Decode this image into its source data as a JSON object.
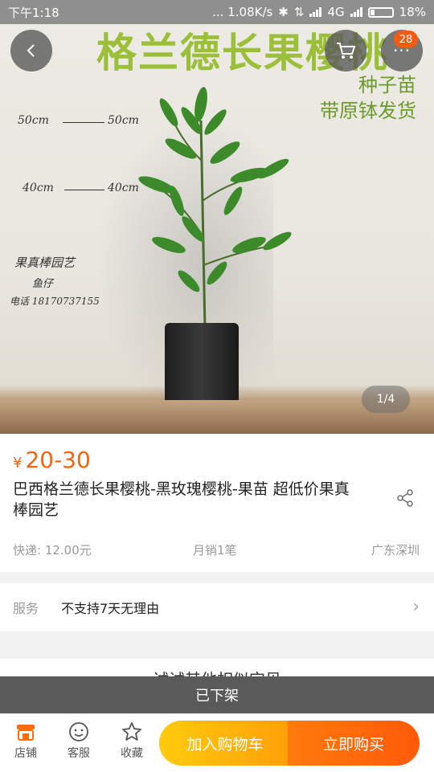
{
  "status_bar": {
    "time": "下午1:18",
    "network_speed": "... 1.08K/s",
    "network_type": "4G",
    "battery": "18%"
  },
  "hero": {
    "overlay_title": "格兰德长果樱桃",
    "overlay_line1": "种子苗",
    "overlay_line2": "带原钵发货",
    "note_top_left": "50cm",
    "note_top_right": "50cm",
    "note_mid_left": "40cm",
    "note_mid_right": "40cm",
    "note_shop": "果真棒园艺",
    "note_name": "鱼仔",
    "note_phone": "电话 18170737155",
    "image_counter": "1/4",
    "cart_badge": "28"
  },
  "product": {
    "currency": "¥",
    "price": "20-30",
    "title": "巴西格兰德长果樱桃-黑玫瑰樱桃-果苗 超低价果真棒园艺",
    "shipping": "快递: 12.00元",
    "monthly_sales": "月销1笔",
    "location": "广东深圳"
  },
  "service": {
    "label": "服务",
    "value": "不支持7天无理由"
  },
  "similar": {
    "heading": "试试其他相似宝贝"
  },
  "offshelf_notice": "已下架",
  "bottom_bar": {
    "shop_label": "店铺",
    "service_label": "客服",
    "favorite_label": "收藏",
    "add_to_cart": "加入购物车",
    "buy_now": "立即购买"
  },
  "colors": {
    "accent": "#f5630f",
    "cart_button": "#ffb40b",
    "buy_button": "#ff6a0b",
    "overlay_green": "#9cbf3a"
  }
}
